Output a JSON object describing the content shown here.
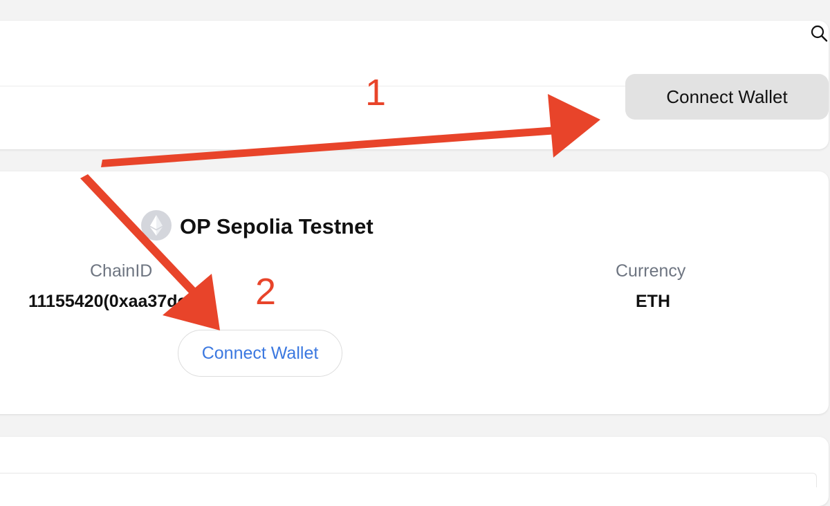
{
  "header": {
    "search_icon": "search-icon",
    "connect_button_label": "Connect Wallet",
    "connect_button_color": "#e2e2e2"
  },
  "network": {
    "logo_icon": "ethereum-icon",
    "name": "OP Sepolia Testnet",
    "chain_id_label": "ChainID",
    "chain_id_value": "11155420(0xaa37dc)",
    "currency_label": "Currency",
    "currency_value": "ETH",
    "connect_button_label": "Connect Wallet",
    "connect_button_color": "#3b78e0"
  },
  "annotations": {
    "color": "#e8442a",
    "step_1": "1",
    "step_2": "2"
  }
}
